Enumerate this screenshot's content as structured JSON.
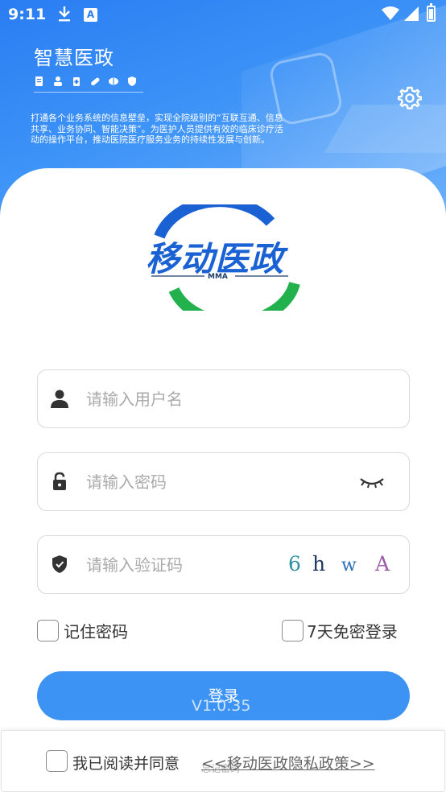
{
  "status_bar": {
    "time": "9:11",
    "ai_badge": "A"
  },
  "header": {
    "title": "智慧医政",
    "description": "打通各个业务系统的信息壁垒，实现全院级别的“互联互通、信息共享、业务协同、智能决策”。为医护人员提供有效的临床诊疗活动的操作平台，推动医院医疗服务业务的持续性发展与创新。",
    "feature_icons": [
      "file-icon",
      "doctor-icon",
      "medicine-icon",
      "pill-icon",
      "brain-icon",
      "shield-icon"
    ]
  },
  "logo": {
    "text": "移动医政",
    "abbr": "MMA"
  },
  "form": {
    "username_placeholder": "请输入用户名",
    "password_placeholder": "请输入密码",
    "captcha_placeholder": "请输入验证码",
    "captcha_chars": [
      "6",
      "h",
      "w",
      "A"
    ]
  },
  "options": {
    "remember_password": "记住密码",
    "auto_login": "7天免密登录"
  },
  "login_button": "登录",
  "version": "V1.0.35",
  "footer": {
    "agree_text": "我已阅读并同意",
    "policy_link": "<<移动医政隐私政策>>",
    "forgot_text": "忘记密码"
  },
  "colors": {
    "primary": "#3c93f4",
    "logo_blue": "#1a62d4",
    "logo_green": "#22b14c"
  }
}
